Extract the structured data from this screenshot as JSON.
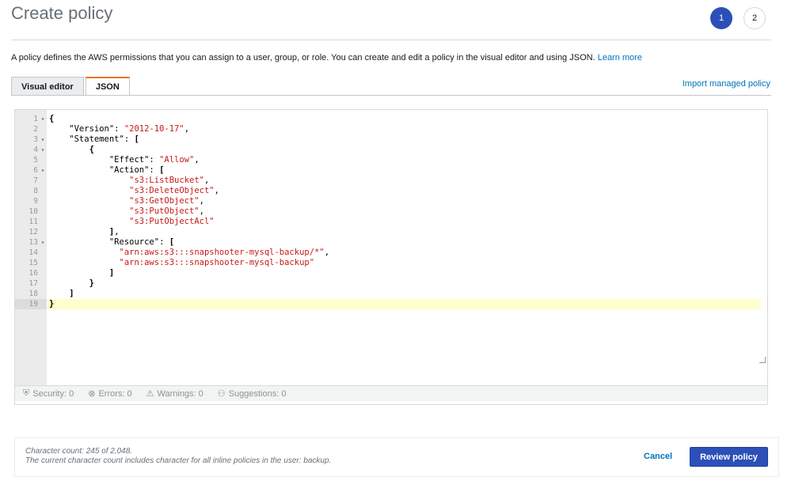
{
  "header": {
    "title": "Create policy",
    "steps": [
      "1",
      "2"
    ]
  },
  "description": {
    "text": "A policy defines the AWS permissions that you can assign to a user, group, or role. You can create and edit a policy in the visual editor and using JSON.",
    "link": "Learn more"
  },
  "tabs": [
    {
      "label": "Visual editor"
    },
    {
      "label": "JSON"
    }
  ],
  "import_link": "Import managed policy",
  "editor": {
    "lines": [
      {
        "n": "1",
        "fold": true,
        "parts": [
          [
            "p",
            "{"
          ]
        ]
      },
      {
        "n": "2",
        "fold": false,
        "parts": [
          [
            "k",
            "    \"Version\": "
          ],
          [
            "s",
            "\"2012-10-17\""
          ],
          [
            "k",
            ","
          ]
        ]
      },
      {
        "n": "3",
        "fold": true,
        "parts": [
          [
            "k",
            "    \"Statement\": "
          ],
          [
            "p",
            "["
          ]
        ]
      },
      {
        "n": "4",
        "fold": true,
        "parts": [
          [
            "p",
            "        {"
          ]
        ]
      },
      {
        "n": "5",
        "fold": false,
        "parts": [
          [
            "k",
            "            \"Effect\": "
          ],
          [
            "s",
            "\"Allow\""
          ],
          [
            "k",
            ","
          ]
        ]
      },
      {
        "n": "6",
        "fold": true,
        "parts": [
          [
            "k",
            "            \"Action\": "
          ],
          [
            "p",
            "["
          ]
        ]
      },
      {
        "n": "7",
        "fold": false,
        "parts": [
          [
            "s",
            "                \"s3:ListBucket\""
          ],
          [
            "k",
            ","
          ]
        ]
      },
      {
        "n": "8",
        "fold": false,
        "parts": [
          [
            "s",
            "                \"s3:DeleteObject\""
          ],
          [
            "k",
            ","
          ]
        ]
      },
      {
        "n": "9",
        "fold": false,
        "parts": [
          [
            "s",
            "                \"s3:GetObject\""
          ],
          [
            "k",
            ","
          ]
        ]
      },
      {
        "n": "10",
        "fold": false,
        "parts": [
          [
            "s",
            "                \"s3:PutObject\""
          ],
          [
            "k",
            ","
          ]
        ]
      },
      {
        "n": "11",
        "fold": false,
        "parts": [
          [
            "s",
            "                \"s3:PutObjectAcl\""
          ]
        ]
      },
      {
        "n": "12",
        "fold": false,
        "parts": [
          [
            "p",
            "            ]"
          ],
          [
            "k",
            ","
          ]
        ]
      },
      {
        "n": "13",
        "fold": true,
        "parts": [
          [
            "k",
            "            \"Resource\": "
          ],
          [
            "p",
            "["
          ]
        ]
      },
      {
        "n": "14",
        "fold": false,
        "parts": [
          [
            "s",
            "              \"arn:aws:s3:::snapshooter-mysql-backup/*\""
          ],
          [
            "k",
            ","
          ]
        ]
      },
      {
        "n": "15",
        "fold": false,
        "parts": [
          [
            "s",
            "              \"arn:aws:s3:::snapshooter-mysql-backup\""
          ]
        ]
      },
      {
        "n": "16",
        "fold": false,
        "parts": [
          [
            "p",
            "            ]"
          ]
        ]
      },
      {
        "n": "17",
        "fold": false,
        "parts": [
          [
            "p",
            "        }"
          ]
        ]
      },
      {
        "n": "18",
        "fold": false,
        "parts": [
          [
            "p",
            "    ]"
          ]
        ]
      },
      {
        "n": "19",
        "fold": false,
        "current": true,
        "parts": [
          [
            "p",
            "}"
          ]
        ]
      }
    ]
  },
  "lint": {
    "security": "Security: 0",
    "errors": "Errors: 0",
    "warnings": "Warnings: 0",
    "suggestions": "Suggestions: 0"
  },
  "footer": {
    "char_count": "Character count: 245 of 2,048.",
    "note": "The current character count includes character for all inline policies in the user: backup.",
    "cancel": "Cancel",
    "review": "Review policy"
  },
  "colors": {
    "primary": "#2c50b8",
    "link": "#0073bb",
    "tab_accent": "#ec7211",
    "string": "#c41a16"
  }
}
